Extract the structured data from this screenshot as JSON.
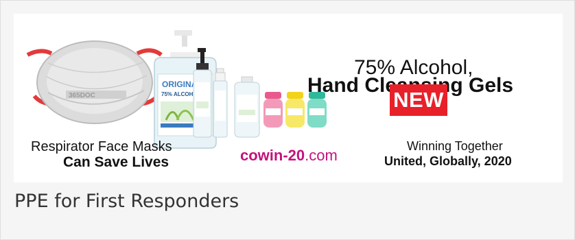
{
  "banner": {
    "alcohol_line1": "75% Alcohol,",
    "alcohol_line2": "Hand Cleansing Gels",
    "new_badge": "NEW",
    "respirator_line1": "Respirator Face Masks",
    "respirator_line2": "Can Save Lives",
    "url_bold": "cowin-20",
    "url_rest": ".com",
    "winning_line1": "Winning Together",
    "winning_line2": "United, Globally, 2020",
    "mask_brand": "365DOC",
    "bottle_label": "ORIGINAL",
    "bottle_sublabel": "75% ALCOHOL",
    "colors": {
      "new_red": "#e8202a",
      "url_magenta": "#c4127c",
      "mask_strap": "#e33a3a"
    }
  },
  "caption": "PPE for First Responders"
}
